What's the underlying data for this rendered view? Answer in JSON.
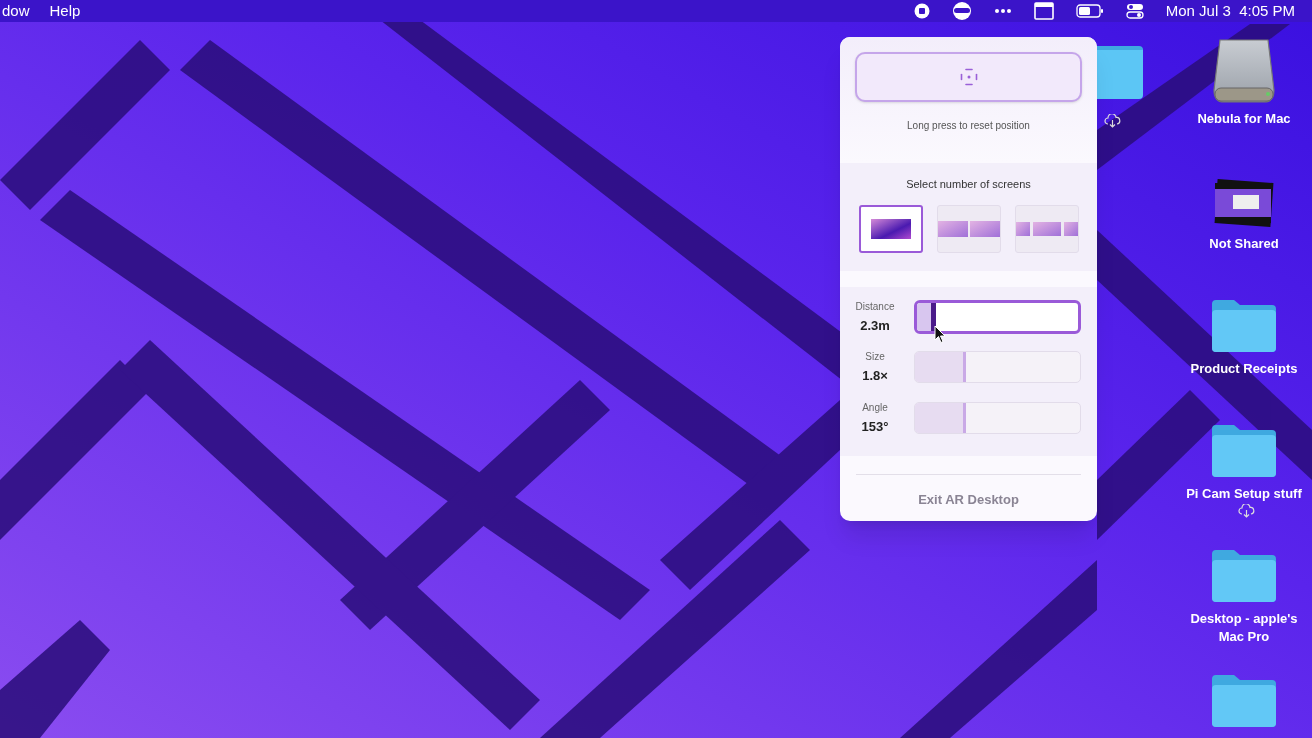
{
  "menu_bar": {
    "menus": [
      "dow",
      "Help"
    ],
    "clock": "Mon Jul 3  4:05 PM"
  },
  "panel": {
    "reset_hint": "Long press to reset position",
    "screens_title": "Select number of screens",
    "screen_options": [
      {
        "kind": "single",
        "selected": true
      },
      {
        "kind": "double",
        "selected": false
      },
      {
        "kind": "triple",
        "selected": false
      }
    ],
    "sliders": [
      {
        "label": "Distance",
        "reading": "2.3m",
        "level": 0.12,
        "active": true
      },
      {
        "label": "Size",
        "reading": "1.8×",
        "level": 0.31,
        "active": false
      },
      {
        "label": "Angle",
        "reading": "153°",
        "level": 0.31,
        "active": false
      }
    ],
    "exit_button": "Exit AR Desktop"
  },
  "desktop_icons": [
    {
      "kind": "drive",
      "label": "Nebula for Mac",
      "cloud": false
    },
    {
      "kind": "image",
      "label": "Not Shared",
      "cloud": false
    },
    {
      "kind": "folder",
      "label": "Product Receipts",
      "cloud": false
    },
    {
      "kind": "folder",
      "label": "Pi Cam Setup stuff",
      "cloud": true
    },
    {
      "kind": "folder",
      "label": "Desktop - apple's Mac Pro",
      "cloud": false
    },
    {
      "kind": "folder",
      "cloud": false
    }
  ],
  "hidden_folder": {
    "cloud": true
  }
}
